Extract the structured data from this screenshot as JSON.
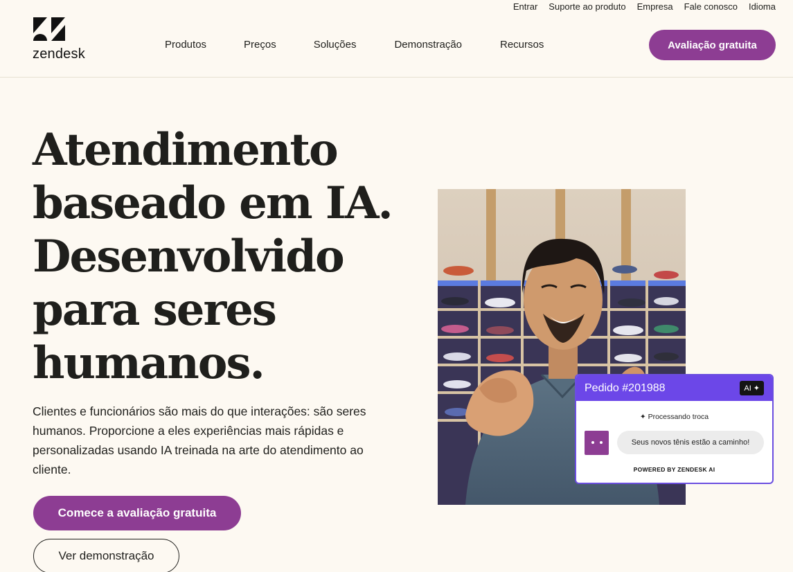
{
  "utility_nav": [
    "Entrar",
    "Suporte ao produto",
    "Empresa",
    "Fale conosco",
    "Idioma"
  ],
  "brand": {
    "name": "zendesk",
    "accent": "#8d3d93",
    "ai_purple": "#6c47e8"
  },
  "main_nav": [
    "Produtos",
    "Preços",
    "Soluções",
    "Demonstração",
    "Recursos"
  ],
  "header_cta": "Avaliação gratuita",
  "hero": {
    "title_lines": [
      "Atendimento",
      "baseado em IA.",
      "Desenvolvido",
      "para seres",
      "humanos."
    ],
    "body": "Clientes e funcionários são mais do que interações: são seres humanos. Proporcione a eles experiências mais rápidas e personalizadas usando IA treinada na arte do atendimento ao cliente.",
    "cta_primary": "Comece a avaliação gratuita",
    "cta_secondary": "Ver demonstração"
  },
  "order_card": {
    "title": "Pedido #201988",
    "badge": "AI",
    "processing": "Processando troca",
    "message": "Seus novos tênis estão a caminho!",
    "powered": "POWERED BY ZENDESK AI"
  }
}
